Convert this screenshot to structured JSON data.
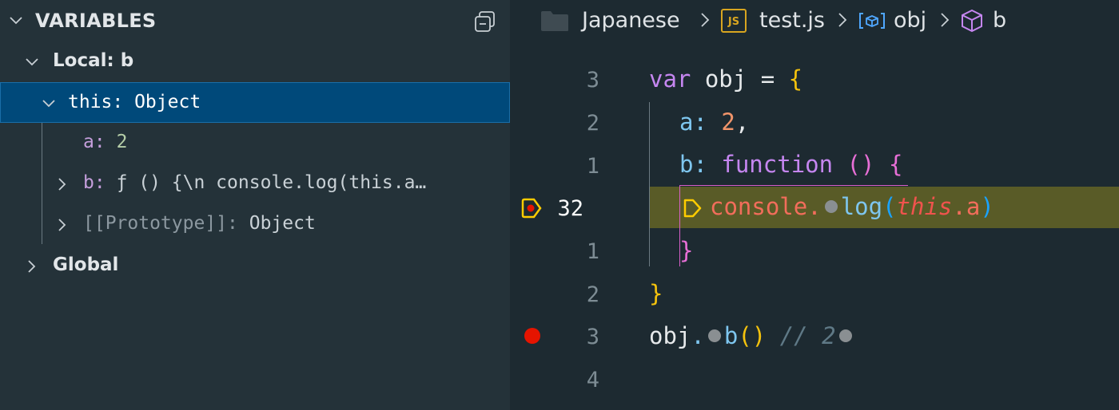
{
  "variables_panel": {
    "title": "VARIABLES",
    "scope_local": "Local: b",
    "this_label": "this: Object",
    "prop_a_name": "a:",
    "prop_a_value": "2",
    "prop_b_name": "b:",
    "prop_b_value": "ƒ () {\\n    console.log(this.a…",
    "prototype_name": "[[Prototype]]:",
    "prototype_value": "Object",
    "scope_global": "Global"
  },
  "breadcrumbs": {
    "folder": "Japanese",
    "file_badge": "JS",
    "file": "test.js",
    "symbol1": "obj",
    "symbol2": "b"
  },
  "editor": {
    "line_numbers": [
      "3",
      "2",
      "1",
      "32",
      "1",
      "2",
      "3",
      "4"
    ],
    "line1": {
      "kw": "var",
      "rest": " obj = ",
      "brace": "{"
    },
    "line2": {
      "prop": "a:",
      "num": "2",
      "comma": ","
    },
    "line3": {
      "prop": "b:",
      "kw": "function",
      "paren": "()",
      "brace": "{"
    },
    "line4": {
      "obj": "console",
      "dot": ".",
      "fn": "log",
      "open": "(",
      "this": "this",
      "prop": ".a",
      "close": ")"
    },
    "line5": {
      "brace": "}"
    },
    "line6": {
      "brace": "}"
    },
    "line7": {
      "obj": "obj",
      "dot": ".",
      "fn": "b",
      "paren": "()",
      "comment": "// 2"
    }
  },
  "colors": {
    "panel_bg": "#243239",
    "selection": "#00497a",
    "editor_bg": "#1d2a31",
    "current_line": "#595b27",
    "breakpoint": "#e51400",
    "paused_arrow": "#ffcc00"
  }
}
